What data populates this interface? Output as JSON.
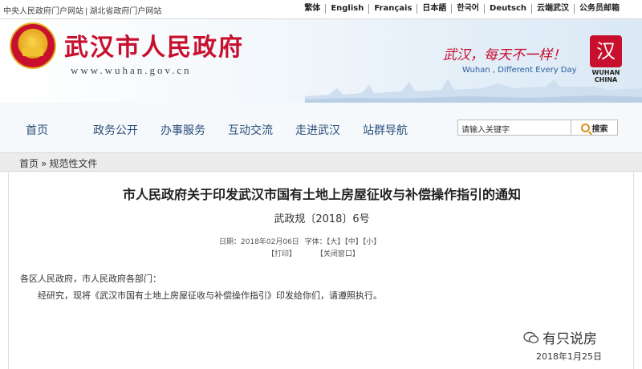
{
  "topbar": {
    "portal_links": [
      "中央人民政府门户网站",
      "|",
      "湖北省政府门户网站"
    ],
    "languages": [
      "繁体",
      "English",
      "Français",
      "日本語",
      "한국어",
      "Deutsch",
      "云端武汉",
      "公务员邮箱"
    ]
  },
  "header": {
    "title": "武汉市人民政府",
    "domain": "www.wuhan.gov.cn",
    "slogan_cn": "武汉，每天不一样！",
    "slogan_en": "Wuhan , Different Every Day",
    "city_logo_text": "WUHAN CHINA"
  },
  "nav": {
    "items": [
      "首页",
      "政务公开",
      "办事服务",
      "互动交流",
      "走进武汉",
      "站群导航"
    ],
    "search_placeholder": "请输入关键字",
    "search_label": "搜索"
  },
  "breadcrumb": {
    "home": "首页",
    "separator": "»",
    "current": "规范性文件"
  },
  "document": {
    "title": "市人民政府关于印发武汉市国有土地上房屋征收与补偿操作指引的通知",
    "number": "武政规〔2018〕6号",
    "date_label": "日期：2018年02月06日",
    "font_label": "字体：",
    "font_sizes": [
      "【大】",
      "【中】",
      "【小】"
    ],
    "print": "【打印】",
    "close": "【关闭窗口】",
    "salutation": "各区人民政府，市人民政府各部门：",
    "body": "经研究，现将《武汉市国有土地上房屋征收与补偿操作指引》印发给你们，请遵照执行。"
  },
  "overlay": {
    "watermark": "有只说房",
    "publish_date": "2018年1月25日"
  },
  "colors": {
    "brand_red": "#c8102e",
    "nav_text": "#2a4e7a"
  }
}
